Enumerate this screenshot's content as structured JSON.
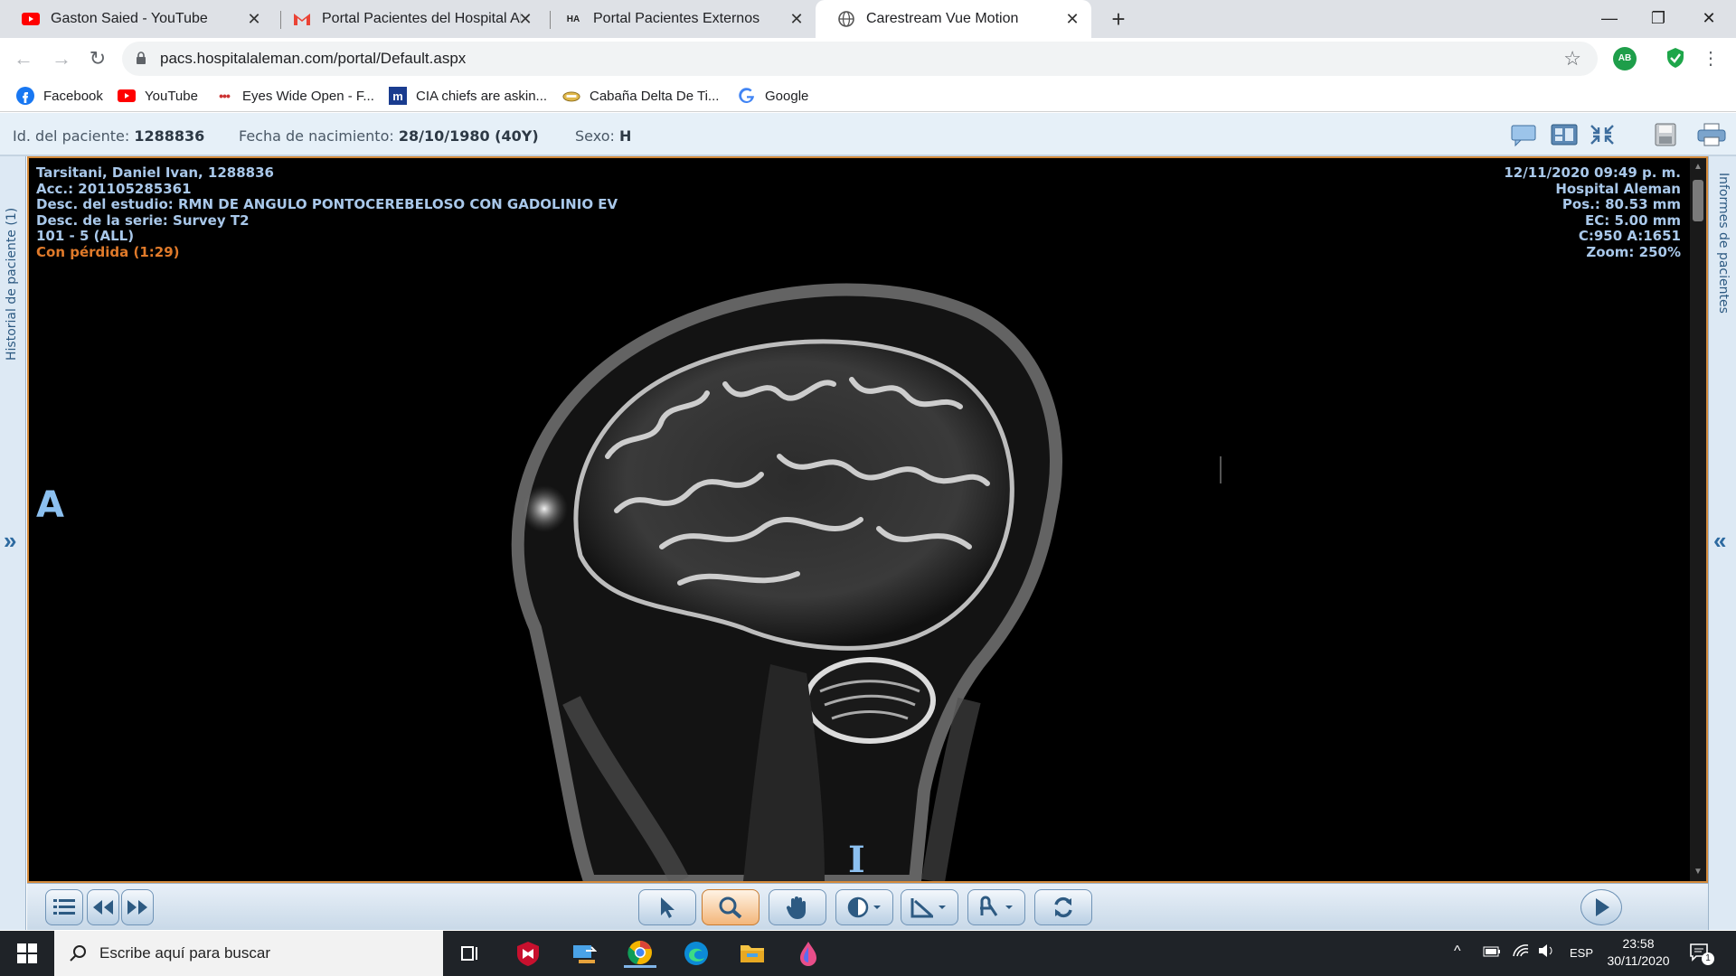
{
  "browser": {
    "tabs": [
      {
        "title": "Gaston Saied - YouTube",
        "icon": "youtube-icon"
      },
      {
        "title": "Portal Pacientes del Hospital Alem",
        "icon": "gmail-icon"
      },
      {
        "title": "Portal Pacientes Externos",
        "icon": "ha-icon"
      },
      {
        "title": "Carestream Vue Motion",
        "icon": "globe-icon"
      }
    ],
    "url": "pacs.hospitalaleman.com/portal/Default.aspx",
    "bookmarks": [
      {
        "label": "Facebook",
        "icon": "facebook-icon"
      },
      {
        "label": "YouTube",
        "icon": "youtube-icon"
      },
      {
        "label": "Eyes Wide Open - F...",
        "icon": "dots-icon"
      },
      {
        "label": "CIA chiefs are askin...",
        "icon": "m-icon"
      },
      {
        "label": "Cabaña Delta De Ti...",
        "icon": "cabin-icon"
      },
      {
        "label": "Google",
        "icon": "google-icon"
      }
    ],
    "extension_ab": "AB"
  },
  "patient_header": {
    "id_label": "Id. del paciente:",
    "id_value": "1288836",
    "dob_label": "Fecha de nacimiento:",
    "dob_value": "28/10/1980 (40Y)",
    "sex_label": "Sexo:",
    "sex_value": "H"
  },
  "side_panels": {
    "left_label": "Historial de paciente (1)",
    "right_label": "Informes de pacientes"
  },
  "viewer": {
    "overlay_left": {
      "line1": "Tarsitani, Daniel Ivan, 1288836",
      "line2": "Acc.: 201105285361",
      "line3": "Desc. del estudio: RMN DE ANGULO PONTOCEREBELOSO CON GADOLINIO EV",
      "line4": "Desc. de la serie: Survey T2",
      "line5": "101 - 5 (ALL)",
      "line6": "Con pérdida (1:29)"
    },
    "overlay_right": {
      "line1": "12/11/2020 09:49 p. m.",
      "line2": "Hospital Aleman",
      "line3": "Pos.: 80.53 mm",
      "line4": "EC: 5.00 mm",
      "line5": "C:950 A:1651",
      "line6": "Zoom: 250%"
    },
    "orientation_left": "A",
    "orientation_bottom": "I",
    "lossy_color": "#e07a2a",
    "overlay_color": "#a9c8ea"
  },
  "taskbar": {
    "search_placeholder": "Escribe aquí para buscar",
    "language": "ESP",
    "time": "23:58",
    "date": "30/11/2020",
    "notification_count": "1"
  }
}
